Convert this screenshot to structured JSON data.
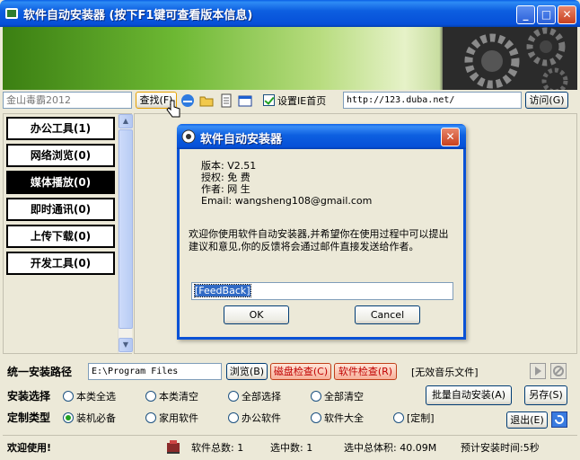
{
  "window": {
    "title": "软件自动安装器 (按下F1键可查看版本信息)",
    "min": "_",
    "max": "□",
    "close": "✕"
  },
  "toolbar": {
    "search_value": "金山毒霸2012",
    "search_label": "查找(F)",
    "set_homepage_label": "设置IE首页",
    "set_homepage_checked": true,
    "url_value": "http://123.duba.net/",
    "visit_label": "访问(G)"
  },
  "categories": [
    {
      "label": "办公工具(1)",
      "active": false
    },
    {
      "label": "网络浏览(0)",
      "active": false
    },
    {
      "label": "媒体播放(0)",
      "active": true
    },
    {
      "label": "即时通讯(0)",
      "active": false
    },
    {
      "label": "上传下载(0)",
      "active": false
    },
    {
      "label": "开发工具(0)",
      "active": false
    }
  ],
  "bottom": {
    "path_label": "统一安装路径",
    "path_value": "E:\\Program Files",
    "browse_label": "浏览(B)",
    "disk_check_label": "磁盘检查(C)",
    "soft_check_label": "软件检查(R)",
    "music_label": "[无效音乐文件]",
    "install_select_label": "安装选择",
    "install_options": [
      "本类全选",
      "本类清空",
      "全部选择",
      "全部清空"
    ],
    "batch_install_label": "批量自动安装(A)",
    "save_as_label": "另存(S)",
    "custom_type_label": "定制类型",
    "type_options": [
      "装机必备",
      "家用软件",
      "办公软件",
      "软件大全",
      "[定制]"
    ],
    "type_selected": "装机必备",
    "exit_label": "退出(E)"
  },
  "status": {
    "welcome": "欢迎使用!",
    "total": "软件总数: 1",
    "selected": "选中数: 1",
    "size": "选中总体积: 40.09M",
    "time": "预计安装时间:5秒"
  },
  "dialog": {
    "title": "软件自动安装器",
    "version": "版本: V2.51",
    "license": "授权: 免 费",
    "author": "作者: 网 生",
    "email": "Email: wangsheng108@gmail.com",
    "message": "欢迎你使用软件自动安装器,并希望你在使用过程中可以提出建议和意见,你的反馈将会通过邮件直接发送给作者。",
    "feedback_value": "[FeedBack]",
    "ok_label": "OK",
    "cancel_label": "Cancel"
  },
  "colors": {
    "titlebar": "#0650D8",
    "active_category_bg": "#000000",
    "check_green": "#21A121",
    "orange_button_text": "#C00000"
  }
}
